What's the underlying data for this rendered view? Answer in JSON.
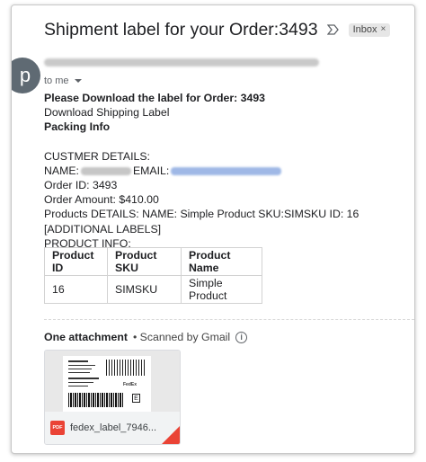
{
  "email": {
    "subject": "Shipment label for your Order:3493",
    "badge_label": "Inbox",
    "badge_close": "×",
    "avatar_letter": "p",
    "to_me": "to me"
  },
  "body": {
    "download_heading": "Please Download the label for Order: 3493",
    "download_link": "Download Shipping Label",
    "packing_info": "Packing Info",
    "customer_details": "CUSTMER DETAILS:",
    "name_label": "NAME:",
    "email_label": "EMAIL:",
    "order_id": "Order ID: 3493",
    "order_amount": "Order Amount: $410.00",
    "products_details": "Products DETAILS: NAME: Simple Product SKU:SIMSKU ID: 16",
    "additional_labels": "[ADDITIONAL LABELS]",
    "product_info": "PRODUCT INFO:"
  },
  "table": {
    "headers": [
      "Product ID",
      "Product SKU",
      "Product Name"
    ],
    "rows": [
      [
        "16",
        "SIMSKU",
        "Simple Product"
      ]
    ]
  },
  "attachments": {
    "title": "One attachment",
    "scanned": "• Scanned by Gmail",
    "info_glyph": "i",
    "file_name": "fedex_label_7946...",
    "file_type": "PDF",
    "preview_carrier": "FedEx",
    "preview_box": "E"
  },
  "colors": {
    "pdf_red": "#ea4335",
    "avatar_gray": "#5f6a73",
    "link_blue": "#1a73e8"
  }
}
